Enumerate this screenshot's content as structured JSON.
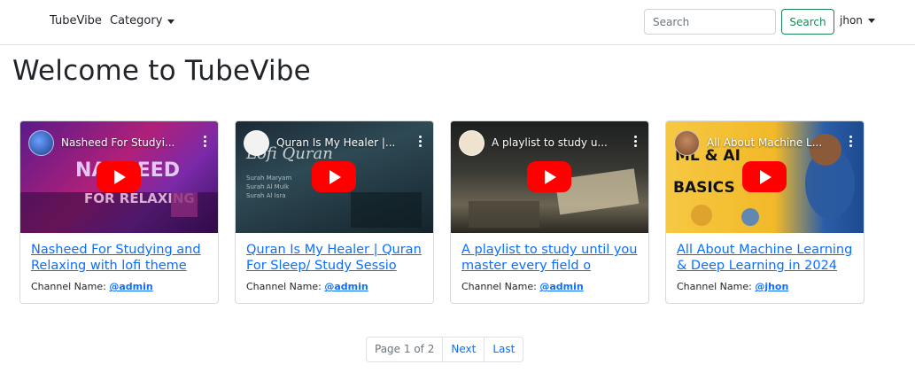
{
  "navbar": {
    "brand": "TubeVibe",
    "category_label": "Category",
    "search_placeholder": "Search",
    "search_button": "Search",
    "user": "jhon"
  },
  "page_title": "Welcome to TubeVibe",
  "videos": [
    {
      "thumb_title": "Nasheed For Studyi...",
      "title": "Nasheed For Studying and Relaxing with lofi theme",
      "channel_label": "Channel Name:",
      "channel": "@admin"
    },
    {
      "thumb_title": "Quran Is My Healer |...",
      "title": "Quran Is My Healer | Quran For Sleep/ Study Sessio",
      "channel_label": "Channel Name:",
      "channel": "@admin"
    },
    {
      "thumb_title": "A playlist to study u...",
      "title": "A playlist to study until you master every field o",
      "channel_label": "Channel Name:",
      "channel": "@admin"
    },
    {
      "thumb_title": "All About Machine L...",
      "title": "All About Machine Learning & Deep Learning in 2024",
      "channel_label": "Channel Name:",
      "channel": "@jhon"
    }
  ],
  "pagination": {
    "info": "Page 1 of 2",
    "next": "Next",
    "last": "Last"
  }
}
